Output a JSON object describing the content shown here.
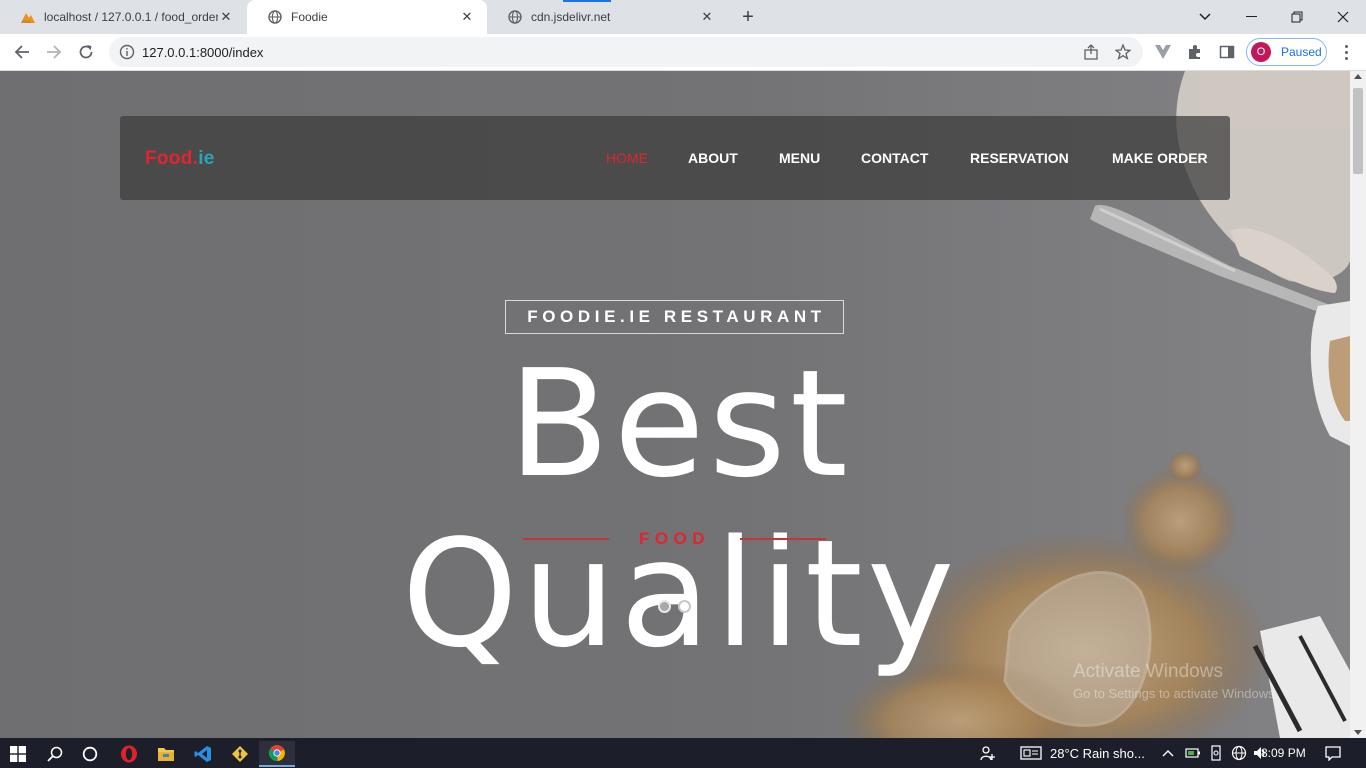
{
  "browser": {
    "tabs": [
      {
        "title": "localhost / 127.0.0.1 / food_order",
        "favicon": "phpmyadmin-icon",
        "active": false
      },
      {
        "title": "Foodie",
        "favicon": "globe-icon",
        "active": true
      },
      {
        "title": "cdn.jsdelivr.net",
        "favicon": "globe-icon",
        "active": false
      }
    ],
    "url": "127.0.0.1:8000/index",
    "profile": {
      "initial": "O",
      "status": "Paused"
    }
  },
  "site": {
    "brand": {
      "part1": "Food.",
      "part2": "ie"
    },
    "nav": [
      "HOME",
      "ABOUT",
      "MENU",
      "CONTACT",
      "RESERVATION",
      "MAKE ORDER"
    ],
    "active_nav": "HOME",
    "hero": {
      "subtitle": "FOODIE.IE RESTAURANT",
      "headline": "Best Quality",
      "tagline": "FOOD",
      "slides": 2,
      "active_slide": 2
    },
    "colors": {
      "accent": "#e1252f",
      "brand_secondary": "#2ba3b8",
      "overlay": "#737375"
    }
  },
  "watermark": {
    "line1": "Activate Windows",
    "line2": "Go to Settings to activate Windows."
  },
  "taskbar": {
    "apps": [
      "windows-start-icon",
      "search-icon",
      "cortana-icon",
      "opera-icon",
      "file-explorer-icon",
      "vscode-icon",
      "git-icon",
      "chrome-icon"
    ],
    "weather": "28°C  Rain sho...",
    "time": "8:09 PM"
  }
}
